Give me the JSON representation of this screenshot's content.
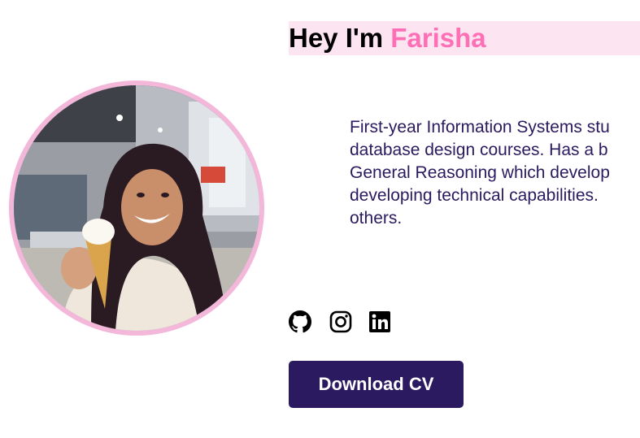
{
  "hero": {
    "greeting": "Hey I'm ",
    "name": "Farisha",
    "name_color": "#ff6fb5",
    "heading_background": "#fde4f1",
    "bio_lines": [
      "First-year Information Systems stu",
      "database design courses. Has a b",
      "General Reasoning which develop",
      "developing technical capabilities.",
      "others."
    ],
    "bio_color": "#2b1a5f"
  },
  "profile_photo": {
    "ring_color": "#f3b7d9"
  },
  "socials": [
    {
      "icon": "github-icon"
    },
    {
      "icon": "instagram-icon"
    },
    {
      "icon": "linkedin-icon"
    }
  ],
  "cta": {
    "download_label": "Download CV",
    "button_color": "#2b1a5f"
  }
}
